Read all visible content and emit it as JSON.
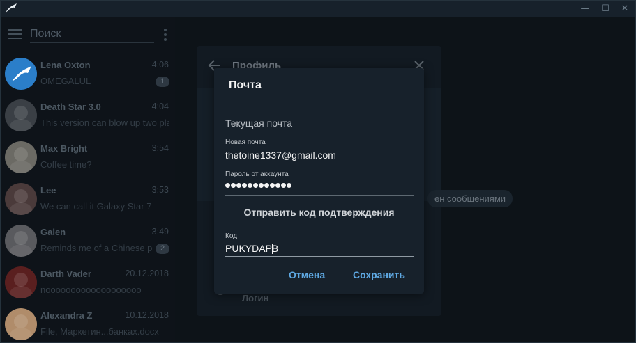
{
  "app": {
    "window_controls": {
      "minimize": "—",
      "maximize": "☐",
      "close": "✕"
    }
  },
  "sidebar": {
    "search_placeholder": "Поиск",
    "chats": [
      {
        "name": "Lena Oxton",
        "time": "4:06",
        "message": "OMEGALUL",
        "badge": "1",
        "avatar_color": "#2b7ec9"
      },
      {
        "name": "Death Star 3.0",
        "time": "4:04",
        "message": "This version can blow up two planets",
        "badge": "",
        "avatar_color": "#3a3f45"
      },
      {
        "name": "Max Bright",
        "time": "3:54",
        "message": "Coffee time?",
        "badge": "",
        "avatar_color": "#6b6a64"
      },
      {
        "name": "Lee",
        "time": "3:53",
        "message": "We can call it Galaxy Star 7",
        "badge": "",
        "avatar_color": "#4a3a3a"
      },
      {
        "name": "Galen",
        "time": "3:49",
        "message": "Reminds me of a Chinese prototype",
        "badge": "2",
        "avatar_color": "#595a5e"
      },
      {
        "name": "Darth Vader",
        "time": "20.12.2018",
        "message": "nooooooooooooooooooo",
        "badge": "",
        "avatar_color": "#5a1f1f"
      },
      {
        "name": "Alexandra Z",
        "time": "10.12.2018",
        "message": "File, Маркетин...банках.docx",
        "badge": "",
        "avatar_color": "#b08c6a"
      }
    ]
  },
  "profile": {
    "title": "Профиль",
    "notifications_chip": "ен сообщениями",
    "login_label": "Логин"
  },
  "dialog": {
    "title": "Почта",
    "current_email_placeholder": "Текущая почта",
    "new_email_label": "Новая почта",
    "new_email_value": "thetoine1337@gmail.com",
    "password_label": "Пароль от аккаунта",
    "password_value": "............",
    "send_code": "Отправить код подтверждения",
    "code_label": "Код",
    "code_value": "PUKYDAPB",
    "cancel": "Отмена",
    "save": "Сохранить"
  },
  "colors": {
    "accent": "#5fa9e3",
    "dialog_bg": "#17212b",
    "window_bg": "#0f151b"
  }
}
